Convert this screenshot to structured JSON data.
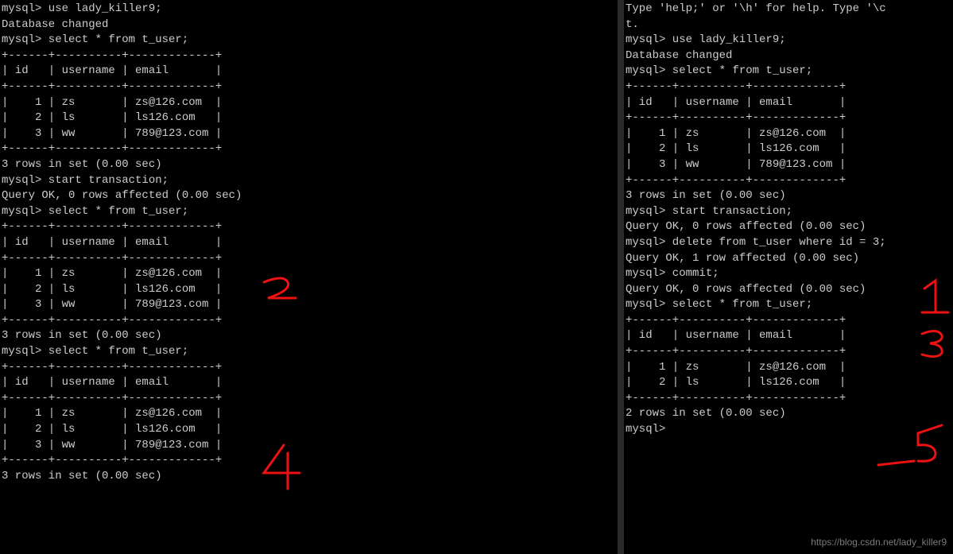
{
  "left": {
    "l1": "mysql> use lady_killer9;",
    "l2": "Database changed",
    "l3": "mysql> select * from t_user;",
    "sep1": "+------+----------+-------------+",
    "hdr": "| id   | username | email       |",
    "sep2": "+------+----------+-------------+",
    "r1": "|    1 | zs       | zs@126.com  |",
    "r2": "|    2 | ls       | ls126.com   |",
    "r3": "|    3 | ww       | 789@123.com |",
    "sep3": "+------+----------+-------------+",
    "rowsmsg": "3 rows in set (0.00 sec)",
    "blank": "",
    "l4": "mysql> start transaction;",
    "l5": "Query OK, 0 rows affected (0.00 sec)",
    "l6": "mysql> select * from t_user;"
  },
  "right": {
    "top1": "Type 'help;' or '\\h' for help. Type '\\c",
    "top2": "t.",
    "l1": "mysql> use lady_killer9;",
    "l2": "Database changed",
    "l3": "mysql> select * from t_user;",
    "sep1": "+------+----------+-------------+",
    "hdr": "| id   | username | email       |",
    "sep2": "+------+----------+-------------+",
    "r1": "|    1 | zs       | zs@126.com  |",
    "r2": "|    2 | ls       | ls126.com   |",
    "r3": "|    3 | ww       | 789@123.com |",
    "sep3": "+------+----------+-------------+",
    "rowsmsg3": "3 rows in set (0.00 sec)",
    "blank": "",
    "l4": "mysql> start transaction;",
    "l5": "Query OK, 0 rows affected (0.00 sec)",
    "l6": "mysql> delete from t_user where id = 3;",
    "l7": "Query OK, 1 row affected (0.00 sec)",
    "l8": "mysql> commit;",
    "l9": "Query OK, 0 rows affected (0.00 sec)",
    "l10": "mysql> select * from t_user;",
    "hdr2": "| id   | username | email       |",
    "r21": "|    1 | zs       | zs@126.com  |",
    "r22": "|    2 | ls       | ls126.com   |",
    "rowsmsg2": "2 rows in set (0.00 sec)",
    "prompt": "mysql>"
  },
  "watermark": "https://blog.csdn.net/lady_killer9",
  "annotations": {
    "a1": "1",
    "a2": "2",
    "a3": "3",
    "a4": "4",
    "a5": "5"
  }
}
